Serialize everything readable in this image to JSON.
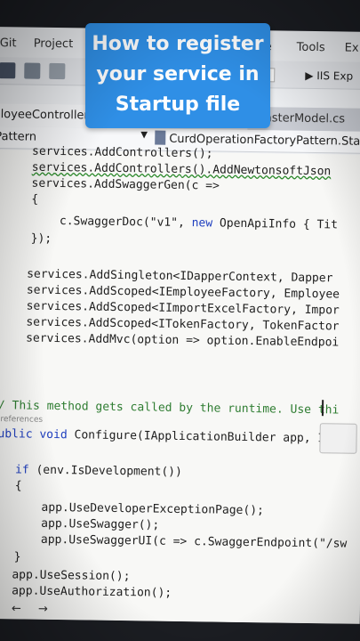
{
  "menu": {
    "git": "Git",
    "project": "Project",
    "tools": "Tools",
    "extensions": "Ex",
    "e": "e"
  },
  "toolbar": {
    "run_target": "IIS Exp"
  },
  "tabs": [
    {
      "label": "loyeeController.cs",
      "active": true
    },
    {
      "label": "MasterModel.cs",
      "active": false
    }
  ],
  "navbar": {
    "left": "Pattern",
    "right": "CurdOperationFactoryPattern.Startu"
  },
  "overlay": {
    "lines": [
      "How to register",
      "your service in",
      "Startup file"
    ]
  },
  "code": {
    "l0": "services.AddControllers();",
    "l1": "services.AddControllers().AddNewtonsoftJson",
    "l2": "services.AddSwaggerGen(c =>",
    "l3": "{",
    "l4a": "c.SwaggerDoc(\"v1\", ",
    "l4b": "new",
    "l4c": " OpenApiInfo { Tit",
    "l5": "});",
    "l6": "services.AddSingleton<IDapperContext, Dapper",
    "l7": "services.AddScoped<IEmployeeFactory, Employee",
    "l8": "services.AddScoped<IImportExcelFactory, Impor",
    "l9": "services.AddScoped<ITokenFactory, TokenFactor",
    "l10": "services.AddMvc(option => option.EnableEndpoi",
    "l11": "}",
    "l12": "// This method gets called by the runtime. Use thi",
    "ref": "0 references",
    "l13a": "public",
    "l13b": "void",
    "l13c": " Configure(IApplicationBuilder app, IWe",
    "l14": "{",
    "l15a": "if",
    "l15b": " (env.IsDevelopment())",
    "l16": "{",
    "l17": "app.UseDeveloperExceptionPage();",
    "l18": "app.UseSwagger();",
    "l19": "app.UseSwaggerUI(c => c.SwaggerEndpoint(\"/sw",
    "l20": "}",
    "l21": "app.UseSession();",
    "l22": "app.UseAuthorization();"
  },
  "colors": {
    "overlay": "#2f8fe6",
    "keyword": "#1f3fbf",
    "comment": "#2f7d32"
  }
}
